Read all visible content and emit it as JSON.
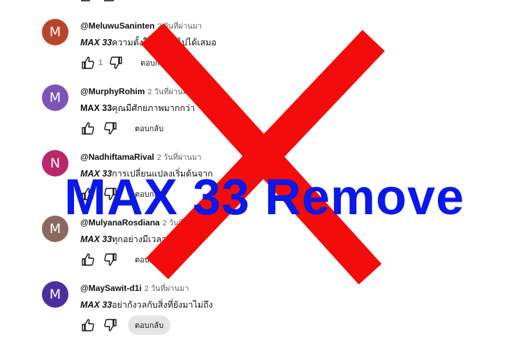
{
  "colors": {
    "cross": "#f40b0b",
    "overlay_text": "#0a18e8",
    "avatar_m1": "#b8452a",
    "avatar_m2": "#7b54b8",
    "avatar_n": "#b8286a",
    "avatar_m3": "#8a6a60",
    "avatar_m4": "#4b2fa0"
  },
  "overlay": {
    "text": "MAX 33 Remove"
  },
  "comments": [
    {
      "avatar_letter": "M",
      "author": "@MeluwuSaninten",
      "time": "2 วันที่ผ่านมา",
      "brand": "MAX 33",
      "text": "ความตั้งใจพาคุณไปได้เสมอ",
      "likes": "1",
      "reply": "ตอบกลับ"
    },
    {
      "avatar_letter": "M",
      "author": "@MurphyRohim",
      "time": "2 วันที่ผ่านมา",
      "brand": "MAX 33",
      "text": "คุณมีศักยภาพมากกว่า",
      "likes": "",
      "reply": "ตอบกลับ"
    },
    {
      "avatar_letter": "N",
      "author": "@NadhiftamaRival",
      "time": "2 วันที่ผ่านมา",
      "brand": "MAX 33",
      "text": "การเปลี่ยนแปลงเริ่มต้นจาก",
      "likes": "",
      "reply": "ตอบกลับ"
    },
    {
      "avatar_letter": "M",
      "author": "@MulyanaRosdiana",
      "time": "2 วันที่ผ่านมา",
      "brand": "MAX 33",
      "text": "ทุกอย่างมีเวลาของมัน",
      "likes": "",
      "reply": "ตอบกลับ"
    },
    {
      "avatar_letter": "M",
      "author": "@MaySawit-d1i",
      "time": "2 วันที่ผ่านมา",
      "brand": "MAX 33",
      "text": "อย่ากังวลกับสิ่งที่ยังมาไม่ถึง",
      "likes": "",
      "reply": "ตอบกลับ"
    }
  ],
  "icons": {
    "like": "thumbs-up-icon",
    "dislike": "thumbs-down-icon"
  }
}
